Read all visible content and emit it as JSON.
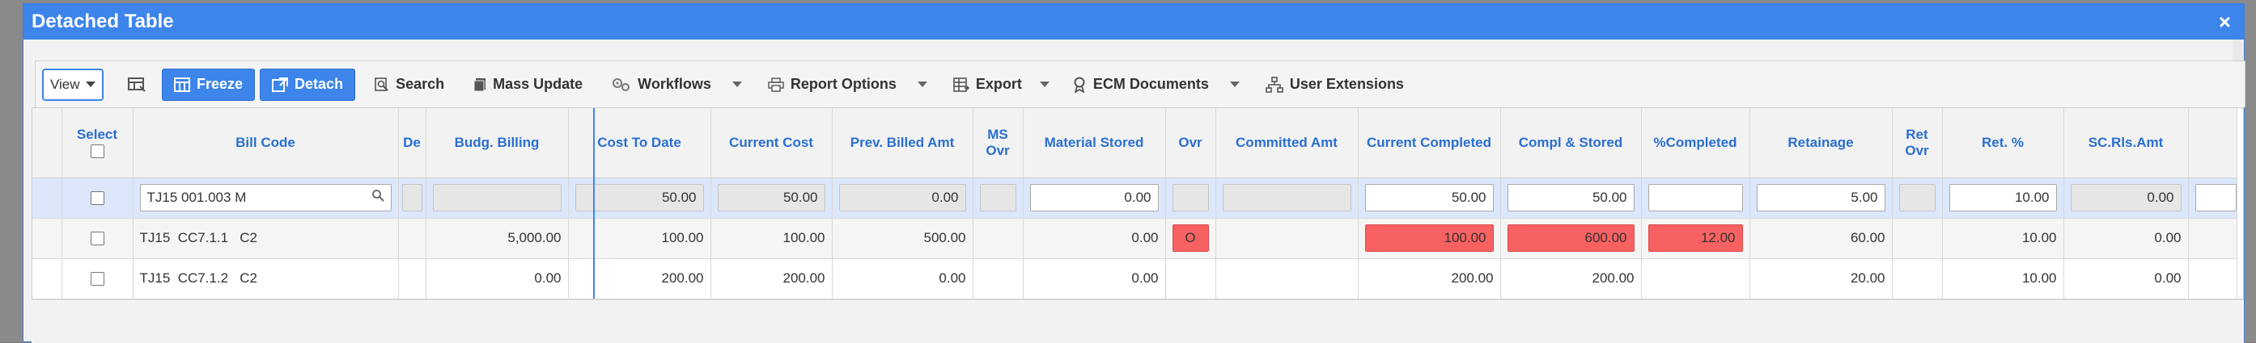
{
  "window": {
    "title": "Detached Table",
    "close_glyph": "×"
  },
  "toolbar": {
    "view_label": "View",
    "freeze_label": "Freeze",
    "detach_label": "Detach",
    "search_label": "Search",
    "mass_update_label": "Mass Update",
    "workflows_label": "Workflows",
    "report_options_label": "Report Options",
    "export_label": "Export",
    "ecm_documents_label": "ECM Documents",
    "user_extensions_label": "User Extensions"
  },
  "grid": {
    "columns": [
      {
        "key": "rowhdr",
        "label": ""
      },
      {
        "key": "select",
        "label": "Select"
      },
      {
        "key": "bill_code",
        "label": "Bill Code"
      },
      {
        "key": "de",
        "label": "De"
      },
      {
        "key": "budg_billing",
        "label": "Budg. Billing"
      },
      {
        "key": "cost_to_date",
        "label": "Cost To Date"
      },
      {
        "key": "current_cost",
        "label": "Current Cost"
      },
      {
        "key": "prev_billed_amt",
        "label": "Prev. Billed Amt"
      },
      {
        "key": "ms_ovr",
        "label": "MS Ovr"
      },
      {
        "key": "material_stored",
        "label": "Material Stored"
      },
      {
        "key": "ovr",
        "label": "Ovr"
      },
      {
        "key": "committed_amt",
        "label": "Committed Amt"
      },
      {
        "key": "current_completed",
        "label": "Current Completed"
      },
      {
        "key": "compl_stored",
        "label": "Compl & Stored"
      },
      {
        "key": "pct_completed",
        "label": "%Completed"
      },
      {
        "key": "retainage",
        "label": "Retainage"
      },
      {
        "key": "ret_ovr",
        "label": "Ret Ovr"
      },
      {
        "key": "ret_pct",
        "label": "Ret. %"
      },
      {
        "key": "sc_rls_amt",
        "label": "SC.Rls.Amt"
      },
      {
        "key": "extra",
        "label": ""
      }
    ],
    "edit_row": {
      "bill_code": "TJ15  001.003   M",
      "cost_to_date": "50.00",
      "current_cost": "50.00",
      "prev_billed_amt": "0.00",
      "material_stored": "0.00",
      "current_completed": "50.00",
      "compl_stored": "50.00",
      "retainage": "5.00",
      "ret_pct": "10.00",
      "sc_rls_amt": "0.00"
    },
    "rows": [
      {
        "bill_code": "TJ15  CC7.1.1   C2",
        "budg_billing": "5,000.00",
        "cost_to_date": "100.00",
        "current_cost": "100.00",
        "prev_billed_amt": "500.00",
        "material_stored": "0.00",
        "ovr": "O",
        "current_completed": "100.00",
        "compl_stored": "600.00",
        "pct_completed": "12.00",
        "retainage": "60.00",
        "ret_pct": "10.00",
        "sc_rls_amt": "0.00"
      },
      {
        "bill_code": "TJ15  CC7.1.2   C2",
        "budg_billing": "0.00",
        "cost_to_date": "200.00",
        "current_cost": "200.00",
        "prev_billed_amt": "0.00",
        "material_stored": "0.00",
        "ovr": "",
        "current_completed": "200.00",
        "compl_stored": "200.00",
        "pct_completed": "",
        "retainage": "20.00",
        "ret_pct": "10.00",
        "sc_rls_amt": "0.00"
      }
    ]
  },
  "colors": {
    "accent": "#3d85ea",
    "warning": "#f86161",
    "header_text": "#2a6fd0"
  }
}
